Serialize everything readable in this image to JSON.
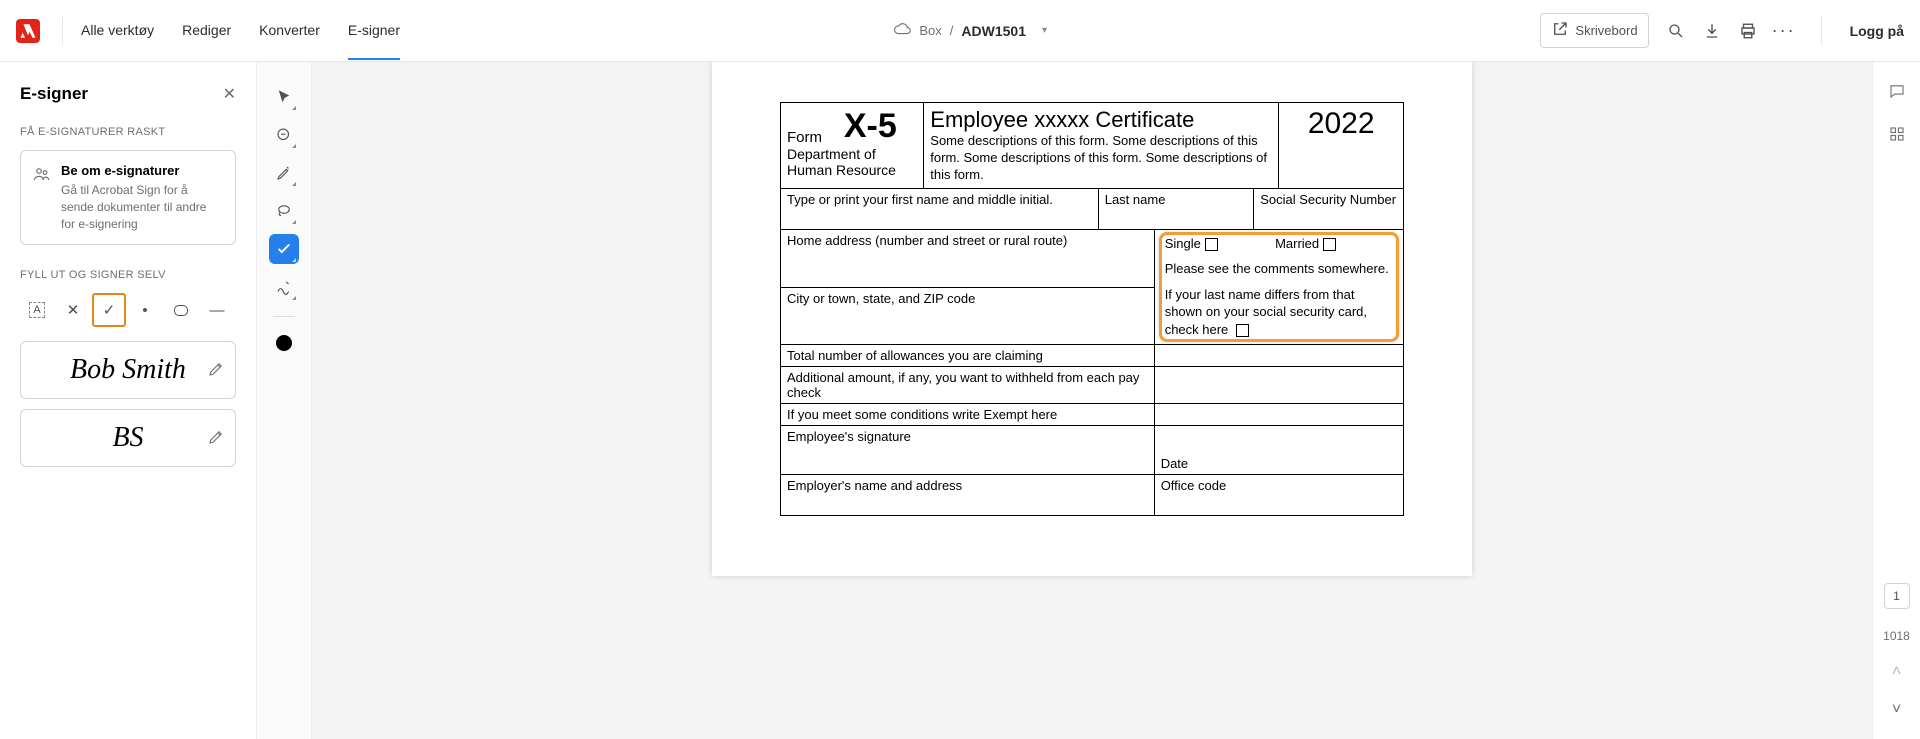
{
  "topbar": {
    "nav": [
      "Alle verktøy",
      "Rediger",
      "Konverter",
      "E-signer"
    ],
    "active_nav": 3,
    "breadcrumb_source": "Box",
    "breadcrumb_sep": "/",
    "doc_name": "ADW1501",
    "desktop_btn": "Skrivebord",
    "login": "Logg på"
  },
  "sidebar": {
    "title": "E-signer",
    "section1": "FÅ E-SIGNATURER RASKT",
    "card_title": "Be om e-signaturer",
    "card_desc": "Gå til Acrobat Sign for å sende dokumenter til andre for e-signering",
    "section2": "FYLL UT OG SIGNER SELV",
    "signature": "Bob Smith",
    "initials": "BS"
  },
  "form": {
    "form_label": "Form",
    "form_num": "X-5",
    "dept": "Department of\nHuman Resource",
    "title": "Employee xxxxx Certificate",
    "desc": "Some descriptions of this form. Some descriptions of this form. Some descriptions of this form. Some descriptions of this form.",
    "year": "2022",
    "r1a": "Type or print your first name and middle initial.",
    "r1b": "Last name",
    "r1c": "Social Security Number",
    "r2a": "Home address (number and street or rural route)",
    "single": "Single",
    "married": "Married",
    "comments": "Please see the comments somewhere.",
    "r3a": "City or town, state, and ZIP code",
    "lastname_diff": "If your last name differs from that shown on your social security card, check here",
    "r4": "Total number of allowances you are claiming",
    "r5": "Additional amount, if any, you want to withheld from each pay check",
    "r6": "If you meet some conditions write Exempt here",
    "r7": "Employee's signature",
    "date": "Date",
    "r8": "Employer's name and address",
    "office": "Office code"
  },
  "right": {
    "page": "1",
    "num": "1018"
  }
}
